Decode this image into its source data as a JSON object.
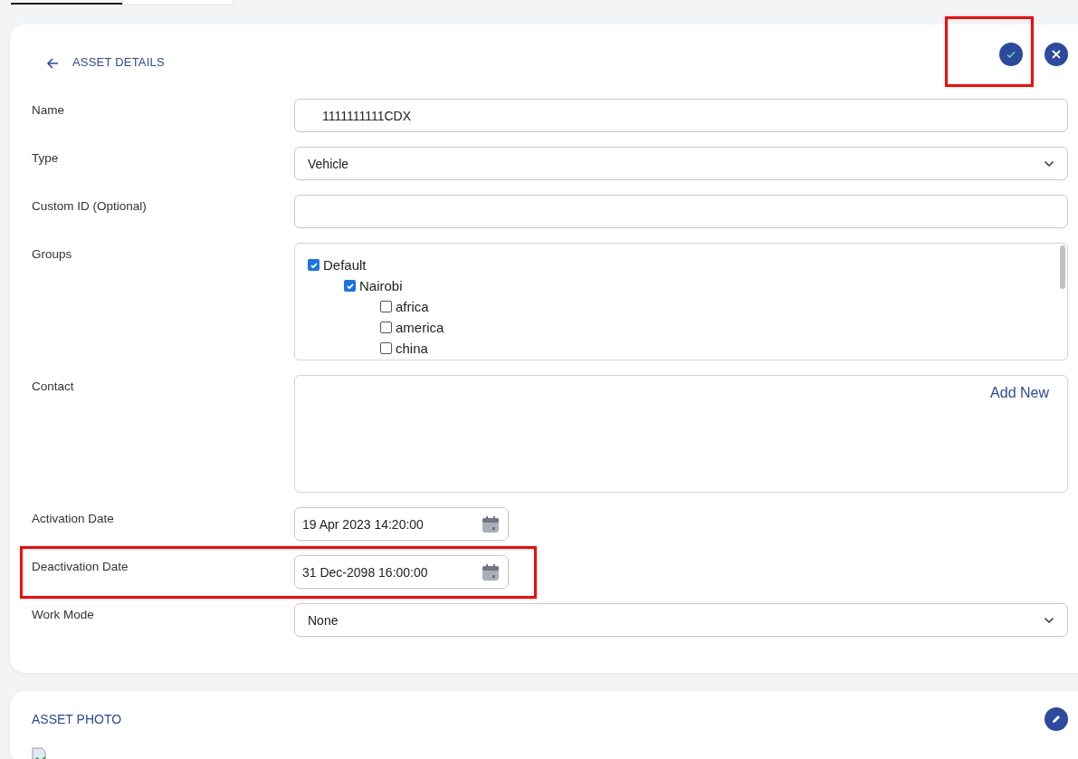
{
  "tabs": [
    {
      "selected": true
    },
    {
      "selected": false
    }
  ],
  "details": {
    "title": "ASSET DETAILS",
    "save_highlighted": true,
    "fields": [
      {
        "kind": "text",
        "label": "Name",
        "value": "1111111111CDX"
      },
      {
        "kind": "select",
        "label": "Type",
        "value": "Vehicle"
      },
      {
        "kind": "text",
        "label": "Custom ID (Optional)"
      },
      {
        "kind": "tree",
        "label": "Groups",
        "items": [
          {
            "label": "Default",
            "checked": true,
            "children": [
              {
                "label": "Nairobi",
                "checked": true,
                "children": [
                  {
                    "label": "africa",
                    "checked": false
                  },
                  {
                    "label": "america",
                    "checked": false
                  },
                  {
                    "label": "china",
                    "checked": false
                  }
                ]
              }
            ]
          }
        ]
      },
      {
        "kind": "contact",
        "label": "Contact",
        "action": "Add New"
      },
      {
        "kind": "date",
        "label": "Activation Date",
        "value": "19 Apr 2023 14:20:00",
        "highlighted": false
      },
      {
        "kind": "date",
        "label": "Deactivation Date",
        "value": "31 Dec-2098 16:00:00",
        "highlighted": true
      },
      {
        "kind": "select",
        "label": "Work Mode",
        "value": "None"
      }
    ]
  },
  "photo": {
    "title": "ASSET PHOTO"
  }
}
